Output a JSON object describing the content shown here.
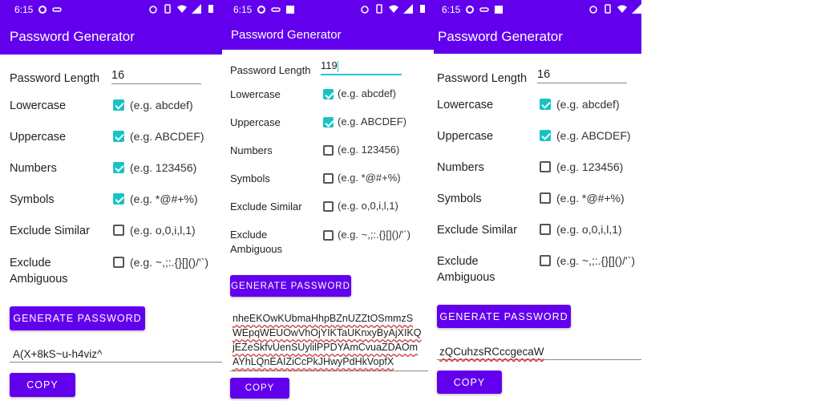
{
  "colors": {
    "primary": "#6200ee",
    "accent": "#18c3c3",
    "error_underline": "#d32f2f"
  },
  "screens": [
    {
      "status_time": "6:15",
      "title": "Password Generator",
      "length_label": "Password Length",
      "length_value": "16",
      "options": [
        {
          "label": "Lowercase",
          "hint": "(e.g. abcdef)",
          "checked": true
        },
        {
          "label": "Uppercase",
          "hint": "(e.g. ABCDEF)",
          "checked": true
        },
        {
          "label": "Numbers",
          "hint": "(e.g. 123456)",
          "checked": true
        },
        {
          "label": "Symbols",
          "hint": "(e.g. *@#+%)",
          "checked": true
        },
        {
          "label": "Exclude Similar",
          "hint": "(e.g. o,0,i,l,1)",
          "checked": false
        },
        {
          "label": "Exclude Ambiguous",
          "hint": "(e.g. ~,;:.{}[]()/'`)",
          "checked": false
        }
      ],
      "generate_label": "GENERATE PASSWORD",
      "password": "A(X+8kS~u-h4viz^",
      "copy_label": "COPY"
    },
    {
      "status_time": "6:15",
      "title": "Password Generator",
      "length_label": "Password Length",
      "length_value": "119",
      "options": [
        {
          "label": "Lowercase",
          "hint": "(e.g. abcdef)",
          "checked": true
        },
        {
          "label": "Uppercase",
          "hint": "(e.g. ABCDEF)",
          "checked": true
        },
        {
          "label": "Numbers",
          "hint": "(e.g. 123456)",
          "checked": false
        },
        {
          "label": "Symbols",
          "hint": "(e.g. *@#+%)",
          "checked": false
        },
        {
          "label": "Exclude Similar",
          "hint": "(e.g. o,0,i,l,1)",
          "checked": false
        },
        {
          "label": "Exclude Ambiguous",
          "hint": "(e.g. ~,;:.{}[]()/'`)",
          "checked": false
        }
      ],
      "generate_label": "GENERATE PASSWORD",
      "password_lines": [
        "nheEKOwKUbmaHhpBZnUZZtOSmmzS",
        "WEpqWEUOwVhOjYIKTaUKnxyByAjXIKQ",
        "jEZeSkfvUenSUylilPPDYAmCvuaZDAOm",
        "AYhLQnEAIZiCcPkJHwyPdHkVopfX"
      ],
      "copy_label": "COPY"
    },
    {
      "status_time": "6:15",
      "title": "Password Generator",
      "length_label": "Password Length",
      "length_value": "16",
      "options": [
        {
          "label": "Lowercase",
          "hint": "(e.g. abcdef)",
          "checked": true
        },
        {
          "label": "Uppercase",
          "hint": "(e.g. ABCDEF)",
          "checked": true
        },
        {
          "label": "Numbers",
          "hint": "(e.g. 123456)",
          "checked": false
        },
        {
          "label": "Symbols",
          "hint": "(e.g. *@#+%)",
          "checked": false
        },
        {
          "label": "Exclude Similar",
          "hint": "(e.g. o,0,i,l,1)",
          "checked": false
        },
        {
          "label": "Exclude Ambiguous",
          "hint": "(e.g. ~,;:.{}[]()/'`)",
          "checked": false
        }
      ],
      "generate_label": "GENERATE PASSWORD",
      "password": "zQCuhzsRCccgecaW",
      "copy_label": "COPY"
    }
  ]
}
